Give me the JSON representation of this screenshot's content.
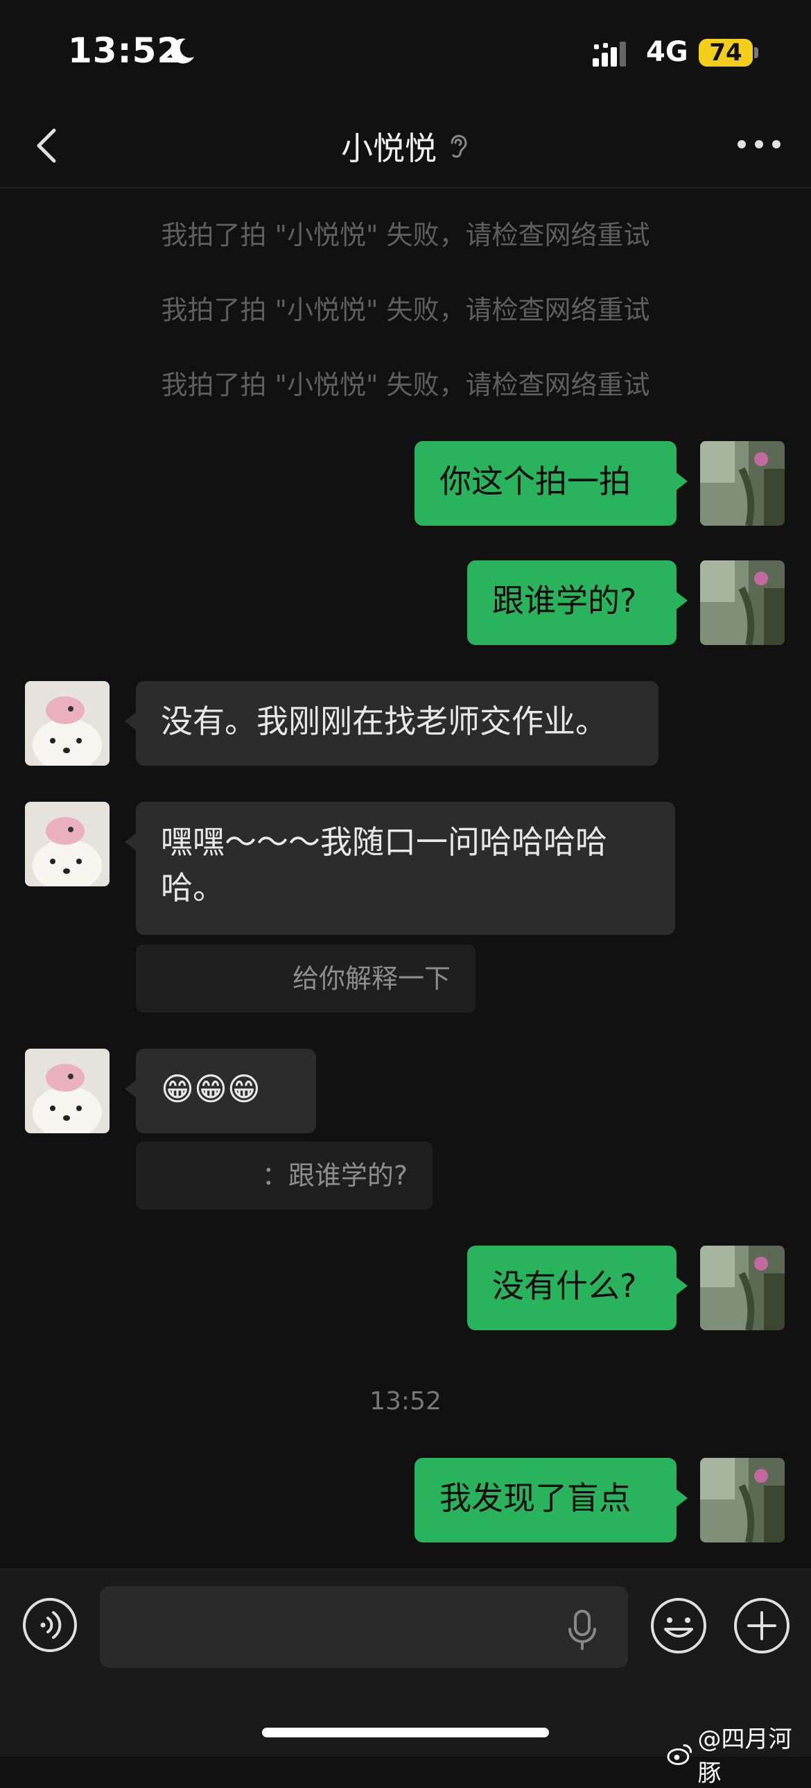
{
  "status_bar": {
    "time": "13:52",
    "network": "4G",
    "battery": "74"
  },
  "header": {
    "title": "小悦悦"
  },
  "notices": [
    "我拍了拍 \"小悦悦\" 失败，请检查网络重试",
    "我拍了拍 \"小悦悦\" 失败，请检查网络重试",
    "我拍了拍 \"小悦悦\" 失败，请检查网络重试"
  ],
  "messages": {
    "m1": "你这个拍一拍",
    "m2": "跟谁学的?",
    "m3": "没有。我刚刚在找老师交作业。",
    "m4": "嘿嘿～～～我随口一问哈哈哈哈哈。",
    "q1": "给你解释一下",
    "m5": "😁😁😁",
    "q2": "：跟谁学的?",
    "m6": "没有什么?",
    "m7": "我发现了盲点"
  },
  "timestamp": "13:52",
  "input": {
    "placeholder": ""
  },
  "watermark": "@四月河豚",
  "colors": {
    "background": "#111111",
    "my_bubble": "#29b35c",
    "other_bubble": "#2c2c2c",
    "battery": "#f3cf1c"
  }
}
